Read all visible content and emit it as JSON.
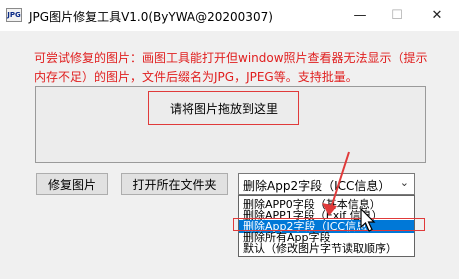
{
  "window": {
    "icon_label": "JPG",
    "title": "JPG图片修复工具V1.0(ByYWA@20200307)",
    "minimize": "—",
    "maximize": "☐",
    "close": "✕"
  },
  "description": "可尝试修复的图片：画图工具能打开但window照片查看器无法显示（提示内存不足）的图片，文件后缀名为JPG，JPEG等。支持批量。",
  "dropzone": {
    "label": "请将图片拖放到这里"
  },
  "buttons": {
    "repair": "修复图片",
    "open_folder": "打开所在文件夹"
  },
  "select": {
    "value": "删除App2字段（ICC信息）",
    "options": [
      "删除APP0字段（基本信息）",
      "删除APP1字段（Exif 信息）",
      "删除App2字段（ICC信息）",
      "删除所有App字段",
      "默认（修改图片字节读取顺序）"
    ],
    "selected_index": 2
  },
  "colors": {
    "accent": "#0078d7",
    "highlight": "#e03a3a",
    "text_red": "#e02020"
  }
}
